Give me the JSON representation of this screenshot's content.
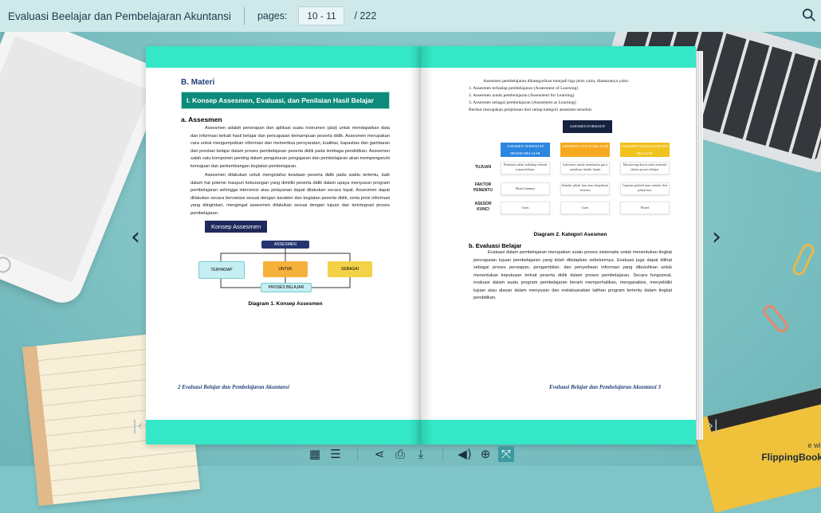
{
  "header": {
    "title": "Evaluasi Beelajar dan Pembelajaran Akuntansi",
    "pages_label": "pages:",
    "pages_value": "10 - 11",
    "pages_total": "/ 222"
  },
  "left_page": {
    "section": "B. Materi",
    "heading": "I. Konsep Assesmen, Evaluasi, dan Penilaian Hasil Belajar",
    "subheading": "a.  Assesmen",
    "p1": "Assesmen adalah penerapan dan aplikasi suatu instrumen (alat) untuk mendapatkan data dan informasi terkait hasil belajar dan pencapaian kemampuan peserta didik. Assesmen merupakan cara untuk mengumpulkan informasi dan memeriksa persyaratan, kualitas, kapasitas dan gambaran dari prestasi belajar dalam proses pembelajaran peserta didik pada lembaga pendidikan. Assesmen salah satu komponen penting dalam pengukuran pengajaran dan pembelajaran akan mempengaruhi kemajuan dan perkembangan kegiatan pembelajaran.",
    "p2": "Assesmen dilakukan untuk mengetahui keadaan peserta didik pada waktu tertentu, baik dalam hal potensi maupun kekurangan yang dimiliki peserta didik dalam upaya menyusun program pembelajaran sehingga intervensi atau pelayanan dapat dilakukan secara tepat. Assesmen dapat dilakukan secara bervariasi sesuai dengan karakter dan kegiatan peserta didik, serta jenis informasi yang diinginkan, mengingat assesmen dilakukan sesuai dengan tujuan dan terintegrasi proses pembelajaran.",
    "box_label": "Konsep Assesmen",
    "diagram": {
      "top": "ASSESMEN",
      "left": "TERHADAP",
      "mid": "UNTUK",
      "right": "SEBAGAI",
      "bottom": "PROSES BELAJAR"
    },
    "caption": "Diagram 1. Konsep Assesmen",
    "footer": "2   Evaluasi Belajar dan Pembelajaran Akuntansi"
  },
  "right_page": {
    "intro": "Assesmen pembelajaran dikategorikan menjadi tiga jenis yaitu, diantaranya yaitu:",
    "list": [
      "1.  Assesmen terhadap pembelajaran (Assesment of Learning)",
      "2.  Assesmen untuk pembelajaran (Assesment for Learning)",
      "3.  Assesmen sebagai pembelajaran (Assesment as Learning)"
    ],
    "list_after": "Berikut merupakan penjelasan dari setiap kategori assesmen tersebut.",
    "table": {
      "title": "ASESMEN FORMATIF",
      "cols": [
        "ASESMEN TERHADAP PROSES BELAJAR",
        "ASESMEN UNTUK BELAJAR",
        "ASESMEN SEBAGAI PROSES BELAJAR"
      ],
      "rows": [
        {
          "label": "TUJUAN",
          "cells": [
            "Penilaian akhir terhadap sebuah tujuan belajar",
            "Informasi untuk membantu guru membuat tindak lanjut",
            "Monitoring dan koreksi mandiri dalam proses belajar"
          ]
        },
        {
          "label": "FAKTOR PENENTU",
          "cells": [
            "Murid lainnya",
            "Standar pihak luar atau ekspektasi tertentu",
            "Capaian pribadi atau standar dari pihak luar"
          ]
        },
        {
          "label": "ASESOR KUNCI",
          "cells": [
            "Guru",
            "Guru",
            "Murid"
          ]
        }
      ]
    },
    "caption": "Diagram 2. Kategori Asesmen",
    "subheading": "b. Evaluasi Belajar",
    "body": "Evaluasi dalam pembelajaran merupakan suatu proses sistematis untuk menentukan tingkat pencapaian tujuan pembelajaran yang telah ditetapkan sebelumnya. Evaluasi juga dapat dilihat sebagai proses persiapan, pengambilan, dan penyediaan informasi yang dibutuhkan untuk menentukan keputusan terkait peserta didik dalam proses pembelajaran. Secara fungsional, evaluasi dalam suatu program pembelajaran berarti memperhatikan, menganalisis, menyelidiki tujuan atau alasan dalam menyusun dan melaksanakan latihan program tertentu dalam tingkat pendidikan.",
    "footer": "Evaluasi Belajar dan Pembelajaran Akuntansi   3"
  },
  "toolbar": {
    "icons": [
      "thumbnails-icon",
      "toc-icon",
      "share-icon",
      "print-icon",
      "download-icon",
      "sound-icon",
      "zoom-icon",
      "fullscreen-icon"
    ]
  },
  "brand": {
    "made": "e wit",
    "name": "FlippingBook"
  }
}
